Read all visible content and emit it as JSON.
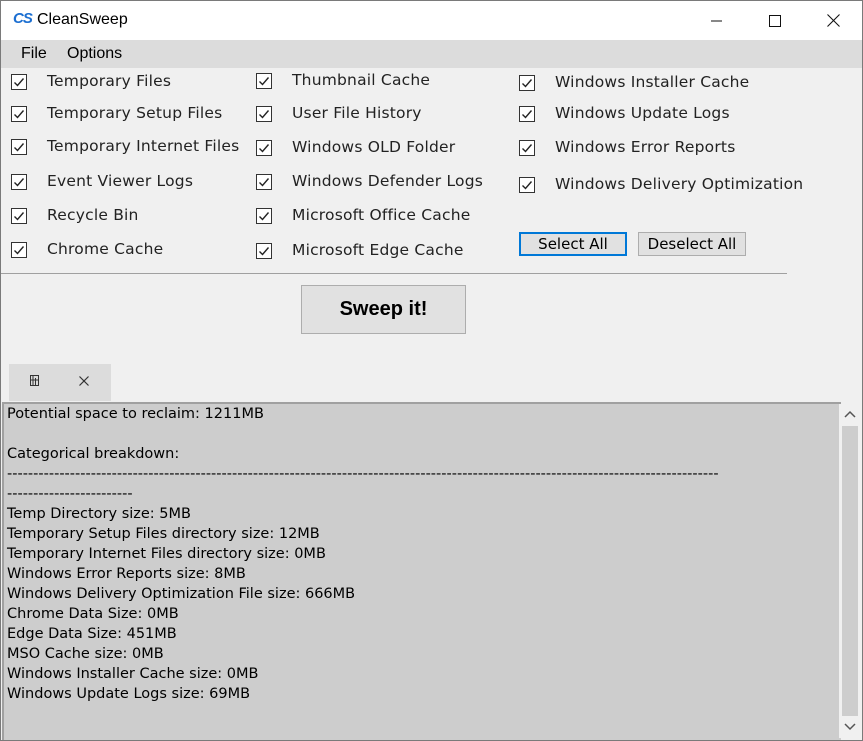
{
  "window": {
    "title": "CleanSweep",
    "icon_text": "CS"
  },
  "menu": {
    "file": "File",
    "options": "Options"
  },
  "checkboxes": {
    "col1": [
      {
        "label": "Temporary Files",
        "checked": true
      },
      {
        "label": "Temporary Setup Files",
        "checked": true
      },
      {
        "label": "Temporary Internet Files",
        "checked": true
      },
      {
        "label": "Event Viewer Logs",
        "checked": true
      },
      {
        "label": "Recycle Bin",
        "checked": true
      },
      {
        "label": "Chrome Cache",
        "checked": true
      }
    ],
    "col2": [
      {
        "label": "Thumbnail Cache",
        "checked": true
      },
      {
        "label": "User File History",
        "checked": true
      },
      {
        "label": "Windows OLD Folder",
        "checked": true
      },
      {
        "label": "Windows Defender Logs",
        "checked": true
      },
      {
        "label": "Microsoft Office Cache",
        "checked": true
      },
      {
        "label": "Microsoft Edge Cache",
        "checked": true
      }
    ],
    "col3": [
      {
        "label": "Windows Installer Cache",
        "checked": true
      },
      {
        "label": "Windows Update Logs",
        "checked": true
      },
      {
        "label": "Windows Error Reports",
        "checked": true
      },
      {
        "label": "Windows Delivery Optimization",
        "checked": true
      }
    ]
  },
  "buttons": {
    "select_all": "Select All",
    "deselect_all": "Deselect All",
    "sweep": "Sweep it!"
  },
  "tab": {
    "icons": [
      "pin-icon",
      "close-icon"
    ]
  },
  "output": {
    "lines": [
      "Potential space to reclaim: 1211MB",
      "",
      "Categorical breakdown:",
      "----------------------------------------------------------------------------------------------------------------------------------------",
      "------------------------",
      "Temp Directory size: 5MB",
      "Temporary Setup Files directory size: 12MB",
      "Temporary Internet Files directory size: 0MB",
      "Windows Error Reports size: 8MB",
      "Windows Delivery Optimization File size: 666MB",
      "Chrome Data Size: 0MB",
      "Edge Data Size: 451MB",
      "MSO Cache size: 0MB",
      "Windows Installer Cache size: 0MB",
      "Windows Update Logs size: 69MB"
    ]
  }
}
